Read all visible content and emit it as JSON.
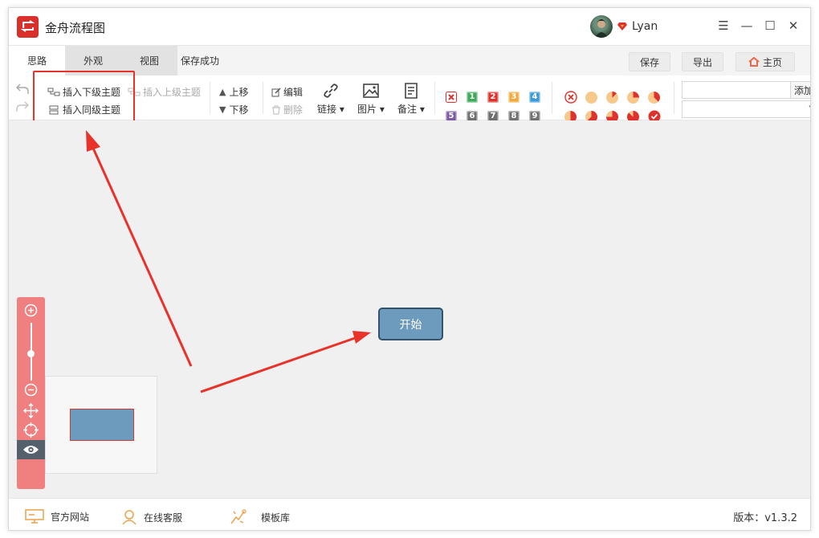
{
  "app": {
    "title": "金舟流程图",
    "user_name": "Lyan"
  },
  "window_controls": {
    "menu": "☰",
    "minimize": "—",
    "maximize": "☐",
    "close": "✕"
  },
  "menu_tabs": [
    {
      "label": "思路",
      "active": true
    },
    {
      "label": "外观",
      "active": false
    },
    {
      "label": "视图",
      "active": false
    }
  ],
  "save_status": "保存成功",
  "top_buttons": {
    "save": "保存",
    "export": "导出",
    "home": "主页"
  },
  "toolbar": {
    "insert_child": "插入下级主题",
    "insert_parent": "插入上级主题",
    "insert_sibling": "插入同级主题",
    "move_up": "上移",
    "move_down": "下移",
    "edit": "编辑",
    "delete": "删除",
    "link": "链接",
    "image": "图片",
    "note": "备注",
    "priorities": [
      "1",
      "2",
      "3",
      "4",
      "5",
      "6",
      "7",
      "8",
      "9"
    ],
    "add_button": "添加",
    "text_value": ""
  },
  "colors": {
    "priority_1": "#3daa5a",
    "priority_2": "#e0322c",
    "priority_3": "#f2a93b",
    "priority_4": "#3b9ad9",
    "priority_5": "#7b5aa6",
    "priority_6": "#707070",
    "priority_7": "#707070",
    "priority_8": "#707070",
    "priority_9": "#707070",
    "progress": "#e0322c",
    "node_fill": "#6d9bbd",
    "annotation": "#e8332a"
  },
  "canvas": {
    "root_node": "开始"
  },
  "footer": {
    "website": "官方网站",
    "support": "在线客服",
    "templates": "模板库",
    "version": "版本：v1.3.2"
  }
}
